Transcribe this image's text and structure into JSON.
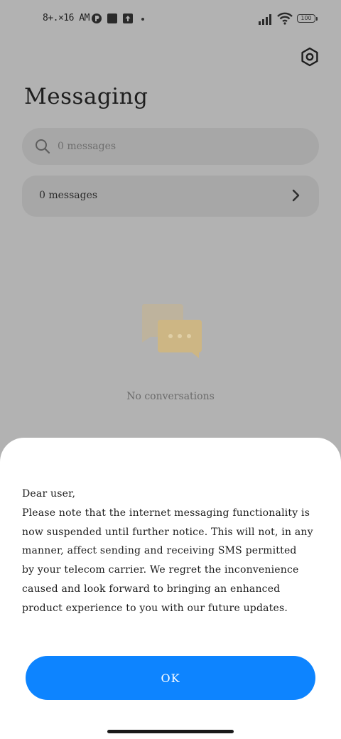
{
  "status_bar": {
    "time": "8+.×16 AM",
    "battery": "100",
    "icons": [
      "app-notification-icon",
      "square-notification-icon",
      "upload-notification-icon",
      "more-dot-icon",
      "signal-icon",
      "wifi-icon",
      "battery-icon"
    ]
  },
  "header": {
    "title": "Messaging",
    "settings_icon": "settings-hexagon-icon"
  },
  "search": {
    "placeholder": "0 messages",
    "icon": "search-icon"
  },
  "messages_row": {
    "label": "0 messages",
    "icon": "chevron-right-icon"
  },
  "empty_state": {
    "icon": "chat-bubbles-icon",
    "label": "No conversations"
  },
  "dialog": {
    "lines": [
      "Dear user,",
      "Please note that the internet messaging functionality is",
      "now suspended until further notice. This will not, in any",
      "manner, affect sending and receiving SMS permitted",
      "by your telecom carrier. We regret the inconvenience",
      "caused and look forward to bringing an enhanced",
      "product experience to you with our future updates."
    ],
    "ok_label": "OK"
  },
  "colors": {
    "background_dim": "#b2b2b2",
    "accent": "#0d84ff",
    "illustration": "#d8c08a"
  }
}
